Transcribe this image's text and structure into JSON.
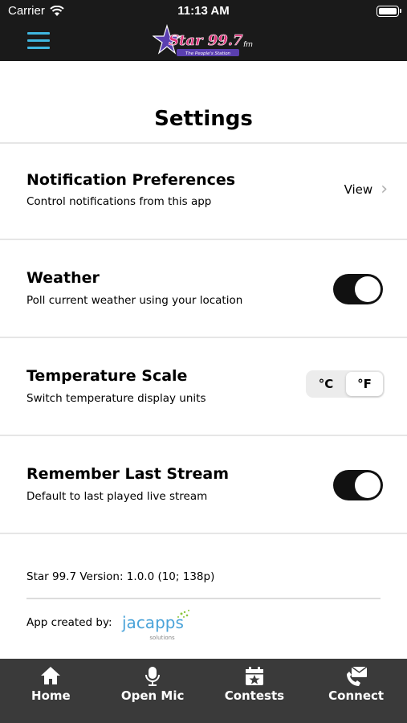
{
  "status_bar": {
    "carrier": "Carrier",
    "time": "11:13 AM"
  },
  "header": {
    "logo": {
      "brand": "Star 99.7",
      "suffix": "fm",
      "tagline": "The People's Station"
    }
  },
  "page": {
    "title": "Settings"
  },
  "settings": [
    {
      "title": "Notification Preferences",
      "subtitle": "Control notifications from this app",
      "action_label": "View"
    },
    {
      "title": "Weather",
      "subtitle": "Poll current weather using your location",
      "enabled": true
    },
    {
      "title": "Temperature Scale",
      "subtitle": "Switch temperature display units",
      "options": [
        "°C",
        "°F"
      ],
      "selected": "°F"
    },
    {
      "title": "Remember Last Stream",
      "subtitle": "Default to last played live stream",
      "enabled": true
    }
  ],
  "footer": {
    "version": "Star 99.7 Version: 1.0.0 (10; 138p)",
    "credit": "App created by:",
    "credit_logo": {
      "name": "jacapps",
      "sub": "solutions"
    }
  },
  "tabs": [
    {
      "label": "Home",
      "icon": "home-icon"
    },
    {
      "label": "Open Mic",
      "icon": "microphone-icon"
    },
    {
      "label": "Contests",
      "icon": "calendar-star-icon"
    },
    {
      "label": "Connect",
      "icon": "envelope-phone-icon"
    }
  ],
  "colors": {
    "bar": "#1a1a1a",
    "accent": "#3fb6e0",
    "tabbar": "#3a3a3a",
    "logo_magenta": "#e0307a",
    "logo_purple": "#5a3fb0",
    "jacapps_green": "#8cc63f"
  }
}
